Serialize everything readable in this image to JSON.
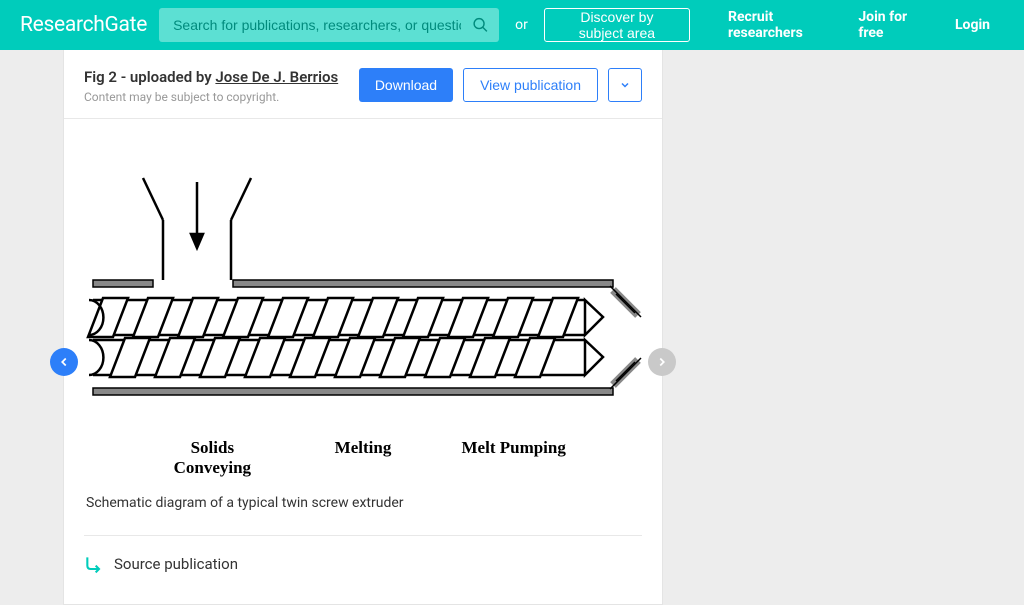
{
  "header": {
    "logo": "ResearchGate",
    "search_placeholder": "Search for publications, researchers, or questions",
    "or": "or",
    "discover": "Discover by subject area",
    "nav": {
      "recruit": "Recruit researchers",
      "join": "Join for free",
      "login": "Login"
    }
  },
  "page": {
    "fig_prefix": "Fig 2 - uploaded by ",
    "author": "Jose De J. Berrios",
    "copyright": "Content may be subject to copyright.",
    "download": "Download",
    "view_pub": "View publication",
    "caption": "Schematic diagram of a typical twin screw extruder",
    "source_pub": "Source publication",
    "diagram_labels": {
      "a": "Solids Conveying",
      "b": "Melting",
      "c": "Melt Pumping"
    }
  }
}
